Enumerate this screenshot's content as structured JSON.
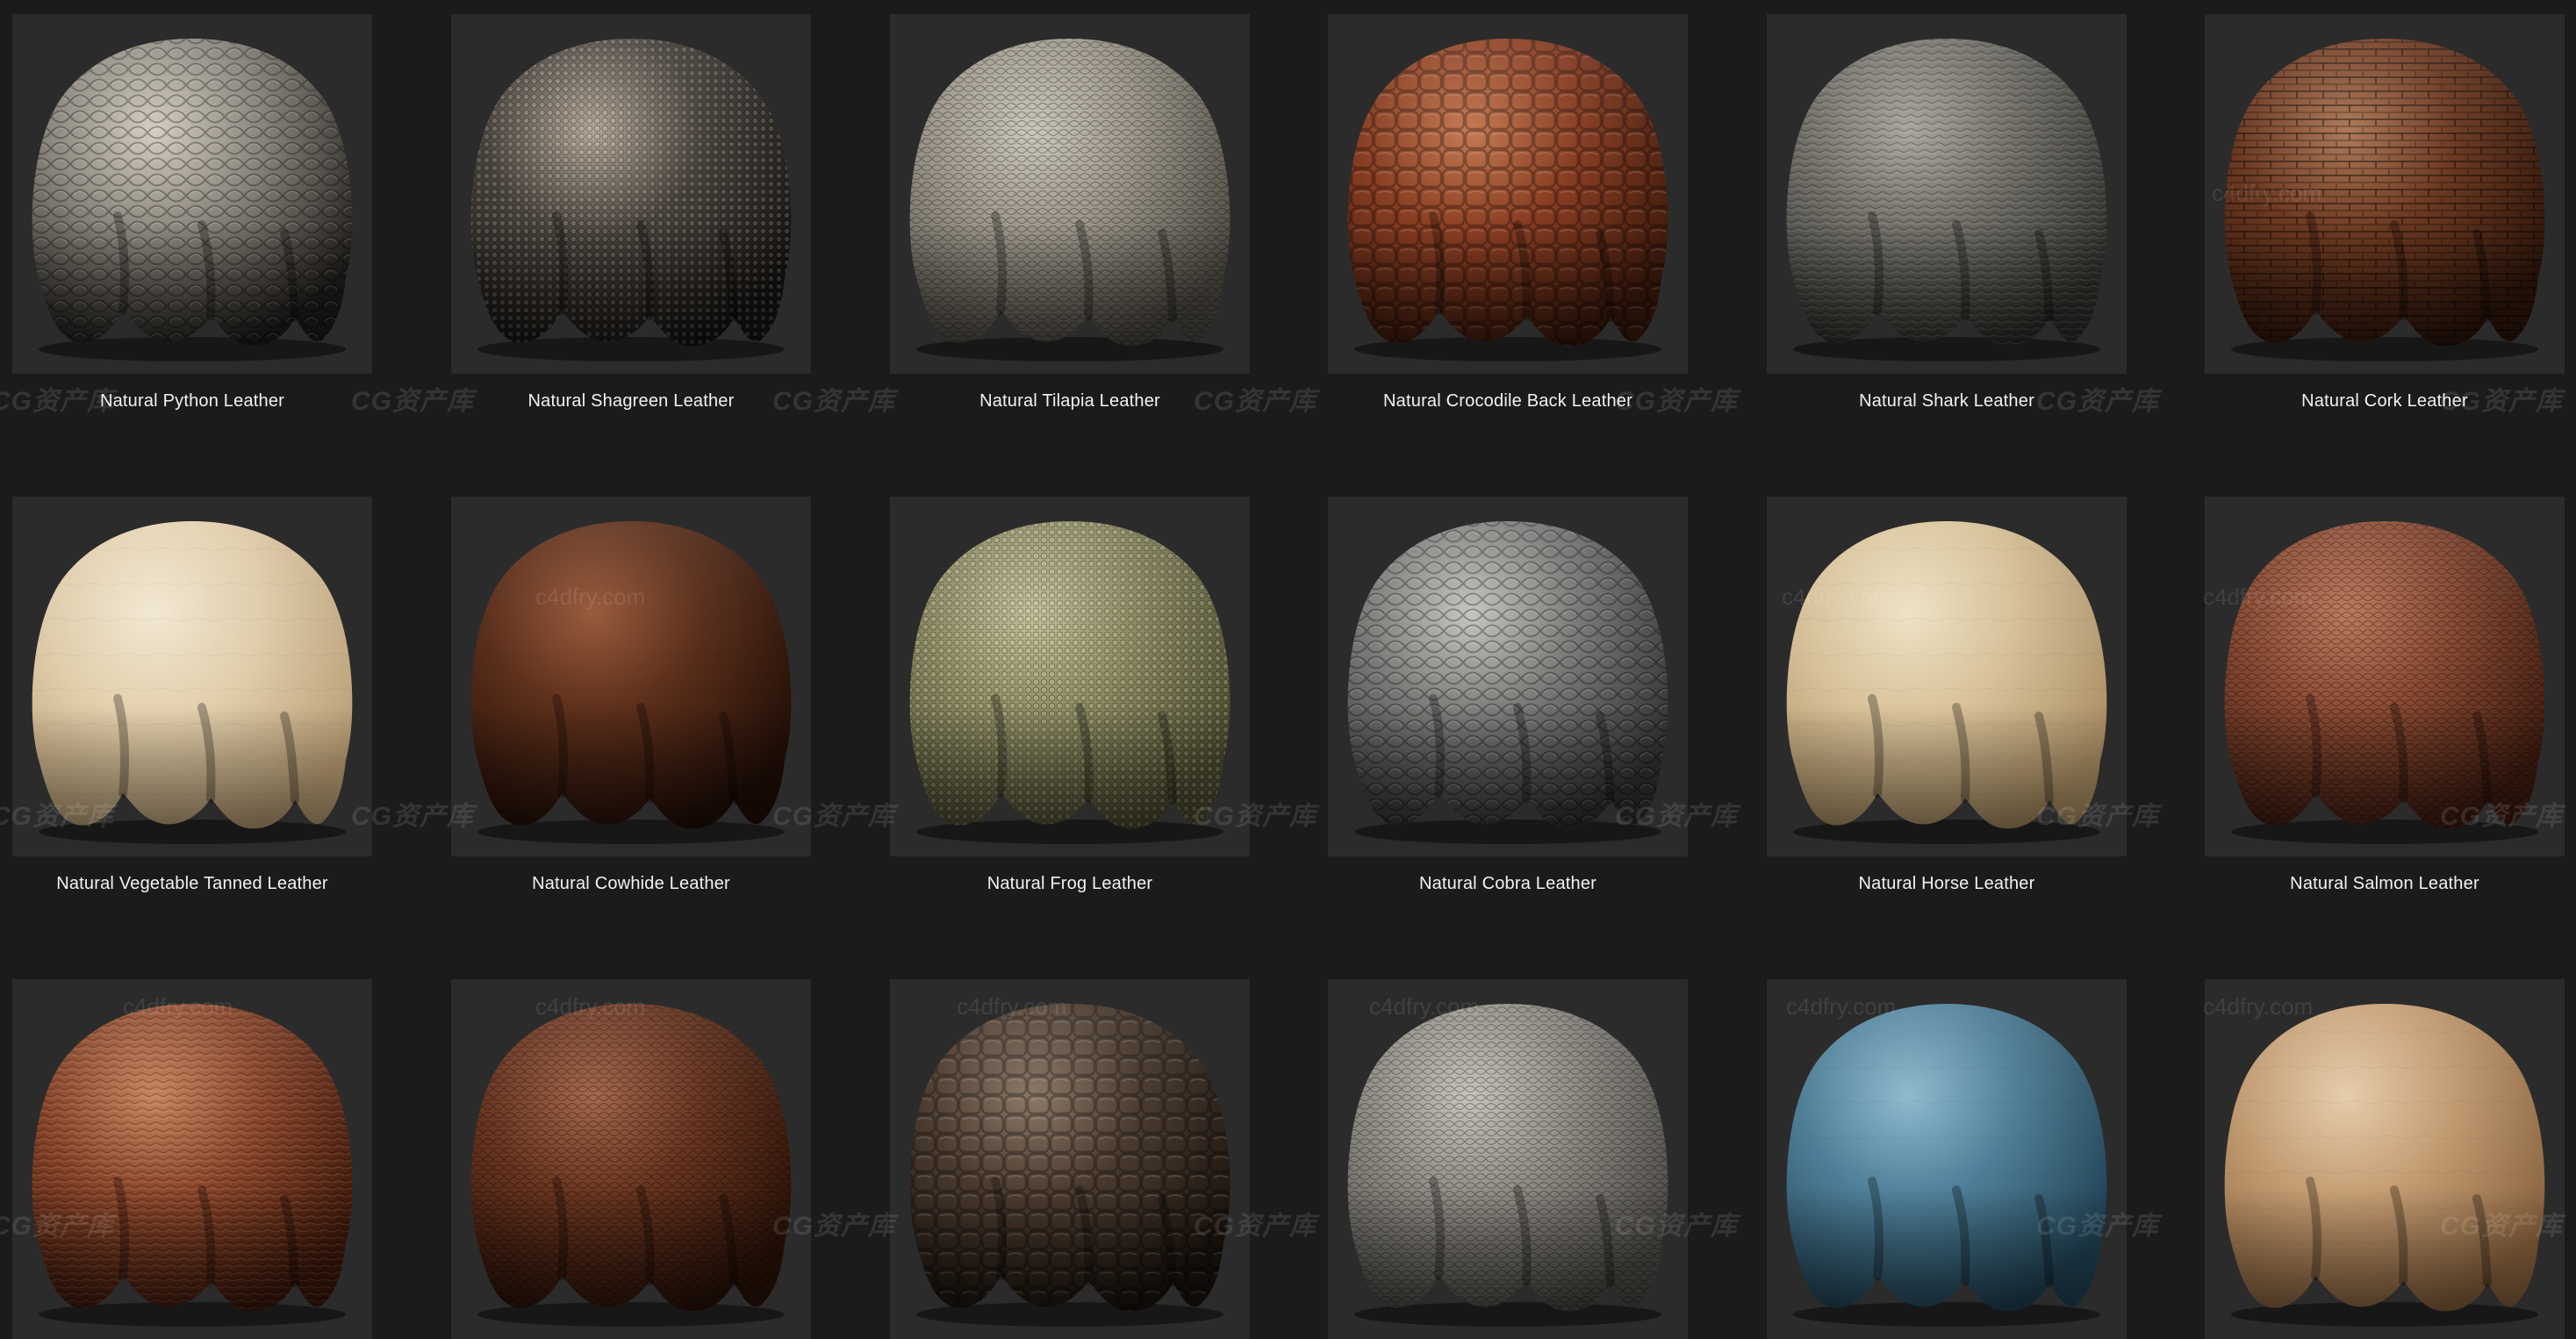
{
  "materials": [
    {
      "name": "Natural Python Leather",
      "base": "#8a857c",
      "light": "#d8d2c4",
      "dark": "#1e1c1a",
      "pattern": "scales"
    },
    {
      "name": "Natural Shagreen Leather",
      "base": "#4a443d",
      "light": "#b7aa98",
      "dark": "#141210",
      "pattern": "dots"
    },
    {
      "name": "Natural Tilapia Leather",
      "base": "#9c968a",
      "light": "#d0cbbf",
      "dark": "#4a4740",
      "pattern": "fine-scales"
    },
    {
      "name": "Natural Crocodile Back Leather",
      "base": "#8a3e22",
      "light": "#c77a52",
      "dark": "#3a180c",
      "pattern": "tiles"
    },
    {
      "name": "Natural Shark Leather",
      "base": "#6f6d66",
      "light": "#a9a79e",
      "dark": "#2e2d2a",
      "pattern": "grain"
    },
    {
      "name": "Natural Cork Leather",
      "base": "#6e3a22",
      "light": "#b07a58",
      "dark": "#2d150a",
      "pattern": "bricks"
    },
    {
      "name": "Natural Vegetable Tanned Leather",
      "base": "#e3d0ad",
      "light": "#f7ecd6",
      "dark": "#b79c73",
      "pattern": "smooth"
    },
    {
      "name": "Natural Cowhide Leather",
      "base": "#5a2e1a",
      "light": "#9a5a3a",
      "dark": "#1f0d06",
      "pattern": "smooth"
    },
    {
      "name": "Natural Frog Leather",
      "base": "#8e8c62",
      "light": "#c6c39a",
      "dark": "#4b4a2e",
      "pattern": "dots"
    },
    {
      "name": "Natural Cobra Leather",
      "base": "#7a7a78",
      "light": "#c8c8c4",
      "dark": "#2f2f2e",
      "pattern": "scales"
    },
    {
      "name": "Natural Horse Leather",
      "base": "#d9c39a",
      "light": "#f3e6c9",
      "dark": "#a88c62",
      "pattern": "smooth"
    },
    {
      "name": "Natural Salmon Leather",
      "base": "#8a4a33",
      "light": "#c07a5c",
      "dark": "#3f1c10",
      "pattern": "fine-scales"
    },
    {
      "name": "",
      "base": "#8a4529",
      "light": "#c9845c",
      "dark": "#3b170a",
      "pattern": "grain"
    },
    {
      "name": "",
      "base": "#6a3520",
      "light": "#a6674a",
      "dark": "#2a1208",
      "pattern": "fine-scales"
    },
    {
      "name": "",
      "base": "#4a3a2e",
      "light": "#8c7866",
      "dark": "#1a130e",
      "pattern": "tiles"
    },
    {
      "name": "",
      "base": "#8f8c85",
      "light": "#c9c6be",
      "dark": "#4a4844",
      "pattern": "fine-scales"
    },
    {
      "name": "",
      "base": "#4e7f98",
      "light": "#8fbdd2",
      "dark": "#1f3f50",
      "pattern": "smooth"
    },
    {
      "name": "",
      "base": "#c49c72",
      "light": "#ead0ad",
      "dark": "#86603c",
      "pattern": "smooth"
    }
  ],
  "watermarks": {
    "cg": "CG资产库",
    "site": "c4dfry.com"
  },
  "icons": {
    "watermark_logo": "cg-logo-icon"
  }
}
